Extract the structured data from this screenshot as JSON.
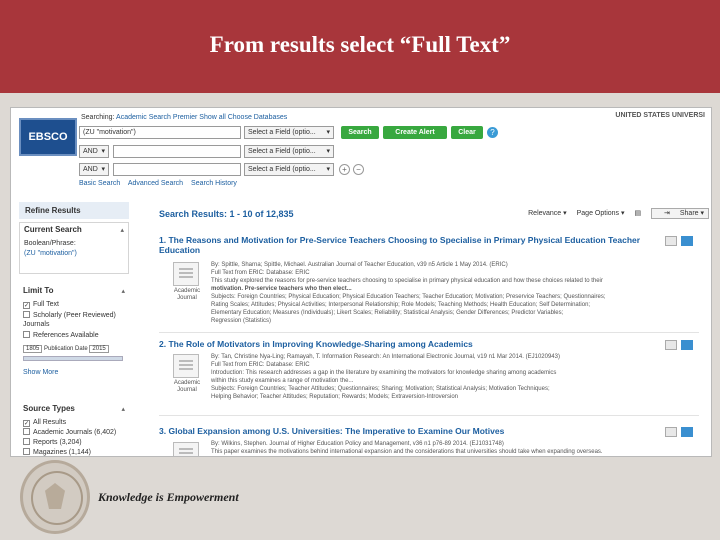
{
  "slide": {
    "title": "From results select “Full Text”",
    "tagline": "Knowledge is Empowerment"
  },
  "ebsco": {
    "logo": "EBSCO",
    "searching_label": "Searching:",
    "database": "Academic Search Premier",
    "show_all": "Show all",
    "choose_databases": "Choose Databases",
    "institution": "UNITED STATES UNIVERSI",
    "rows": [
      {
        "value": "(ZU \"motivation\")",
        "field": "Select a Field (optio..."
      },
      {
        "bool": "AND",
        "value": "",
        "field": "Select a Field (optio..."
      },
      {
        "bool": "AND",
        "value": "",
        "field": "Select a Field (optio..."
      }
    ],
    "buttons": {
      "search": "Search",
      "alert": "Create Alert",
      "clear": "Clear",
      "help": "?"
    },
    "add_row": "+",
    "remove_row": "−",
    "subnav": [
      "Basic Search",
      "Advanced Search",
      "Search History"
    ]
  },
  "sidebar": {
    "refine_title": "Refine Results",
    "current_search_title": "Current Search",
    "boolean_phrase_label": "Boolean/Phrase:",
    "boolean_phrase_value": "(ZU \"motivation\")",
    "limit_to_title": "Limit To",
    "limits": [
      {
        "label": "Full Text",
        "checked": true
      },
      {
        "label": "Scholarly (Peer Reviewed) Journals",
        "checked": false
      },
      {
        "label": "References Available",
        "checked": false
      }
    ],
    "date_from": "1805",
    "date_label": "Publication Date",
    "date_to": "2015",
    "show_more": "Show More",
    "source_types_title": "Source Types",
    "sources": [
      {
        "label": "All Results",
        "checked": true
      },
      {
        "label": "Academic Journals (6,402)",
        "checked": false
      },
      {
        "label": "Reports (3,204)",
        "checked": false
      },
      {
        "label": "Magazines (1,144)",
        "checked": false
      }
    ]
  },
  "results": {
    "heading": "Search Results: 1 - 10 of 12,835",
    "sort": "Relevance ▾",
    "page_options": "Page Options ▾",
    "share": "Share ▾",
    "items": [
      {
        "number": "1.",
        "title": "The Reasons and Motivation for Pre-Service Teachers Choosing to Specialise in Primary Physical Education Teacher Education",
        "doc_type": "Academic Journal",
        "meta": [
          "By: Spittle, Sharna; Spittle, Michael. Australian Journal of Teacher Education, v39 n5 Article 1 May 2014. (ERIC)",
          "Full Text from ERIC: Database: ERIC",
          "This study explored the reasons for pre-service teachers choosing to specialise in primary physical education and how these choices related to their",
          "motivation. Pre-service teachers who then elect...",
          "Subjects: Foreign Countries; Physical Education; Physical Education Teachers; Teacher Education; Motivation; Preservice Teachers; Questionnaires;",
          "Rating Scales; Attitudes; Physical Activities; Interpersonal Relationship; Role Models; Teaching Methods; Health Education; Self Determination;",
          "Elementary Education; Measures (Individuals); Likert Scales; Reliability; Statistical Analysis; Gender Differences; Predictor Variables;",
          "Regression (Statistics)"
        ]
      },
      {
        "number": "2.",
        "title": "The Role of Motivators in Improving Knowledge-Sharing among Academics",
        "doc_type": "Academic Journal",
        "meta": [
          "By: Tan, Christine Nya-Ling; Ramayah, T. Information Research: An International Electronic Journal, v19 n1 Mar 2014. (EJ1020943)",
          "Full Text from ERIC: Database: ERIC",
          "Introduction: This research addresses a gap in the literature by examining the motivators for knowledge sharing among academics",
          "within this study examines a range of motivation the...",
          "Subjects: Foreign Countries; Teacher Attitudes; Questionnaires; Sharing; Motivation; Statistical Analysis; Motivation Techniques;",
          "Helping Behavior; Teacher Attitudes; Reputation; Rewards; Models; Extraversion-Introversion"
        ]
      },
      {
        "number": "3.",
        "title": "Global Expansion among U.S. Universities: The Imperative to Examine Our Motives",
        "doc_type": "Academic Journal",
        "meta": [
          "By: Wilkins, Stephen. Journal of Higher Education Policy and Management, v36 n1 p76-89 2014. (EJ1031748)",
          "This paper examines the motivations behind international expansion and the considerations that universities should take when expanding overseas."
        ]
      }
    ]
  },
  "colors": {
    "header_band": "#a8363b",
    "slide_background": "#ddd9d4",
    "link_blue": "#1d5fa0",
    "button_green": "#38a83f"
  },
  "icons": [
    "college-seal-icon",
    "document-icon",
    "pdf-icon",
    "folder-icon",
    "share-icon",
    "chevron-icon",
    "checkbox-icon",
    "help-icon"
  ]
}
